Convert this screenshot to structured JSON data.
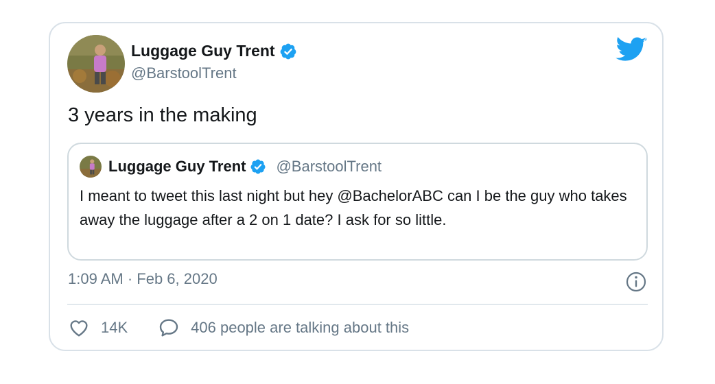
{
  "tweet": {
    "author": {
      "display_name": "Luggage Guy Trent",
      "handle": "@BarstoolTrent",
      "verified": true,
      "avatar_icon": "profile-photo"
    },
    "text": "3 years in the making",
    "quoted_tweet": {
      "author": {
        "display_name": "Luggage Guy Trent",
        "handle": "@BarstoolTrent",
        "verified": true,
        "avatar_icon": "profile-photo"
      },
      "text": "I meant to tweet this last night but hey @BachelorABC can I be the guy who takes away the luggage after a 2 on 1 date? I ask for so little."
    },
    "timestamp": "1:09 AM · Feb 6, 2020",
    "likes": "14K",
    "talking": "406 people are talking about this"
  },
  "icons": {
    "brand": "twitter-bird-icon",
    "verified": "verified-badge-icon",
    "info": "info-icon",
    "like": "heart-icon",
    "reply": "speech-bubble-icon"
  },
  "colors": {
    "brand_blue": "#1da1f2",
    "secondary_text": "#657786",
    "border": "#d9e1e8",
    "primary_text": "#14171a"
  }
}
